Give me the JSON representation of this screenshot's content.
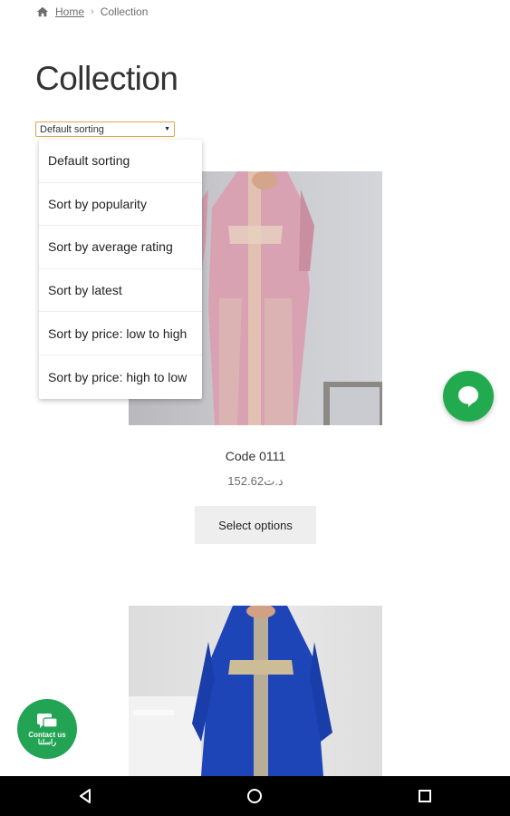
{
  "breadcrumb": {
    "home": "Home",
    "separator": "›",
    "current": "Collection"
  },
  "page_title": "Collection",
  "sorting": {
    "selected": "Default sorting",
    "options": [
      "Default sorting",
      "Sort by popularity",
      "Sort by average rating",
      "Sort by latest",
      "Sort by price: low to high",
      "Sort by price: high to low"
    ]
  },
  "products": [
    {
      "name": "Code 0111",
      "price": "152.62د.ت",
      "button": "Select options"
    }
  ],
  "contact_fab": {
    "label_en": "Contact us",
    "label_ar": "راسلنا"
  },
  "colors": {
    "accent_green": "#22aa4f",
    "select_border": "#e0a449",
    "dress_pink": "#d8a2b3",
    "dress_blue": "#1e45b8"
  }
}
